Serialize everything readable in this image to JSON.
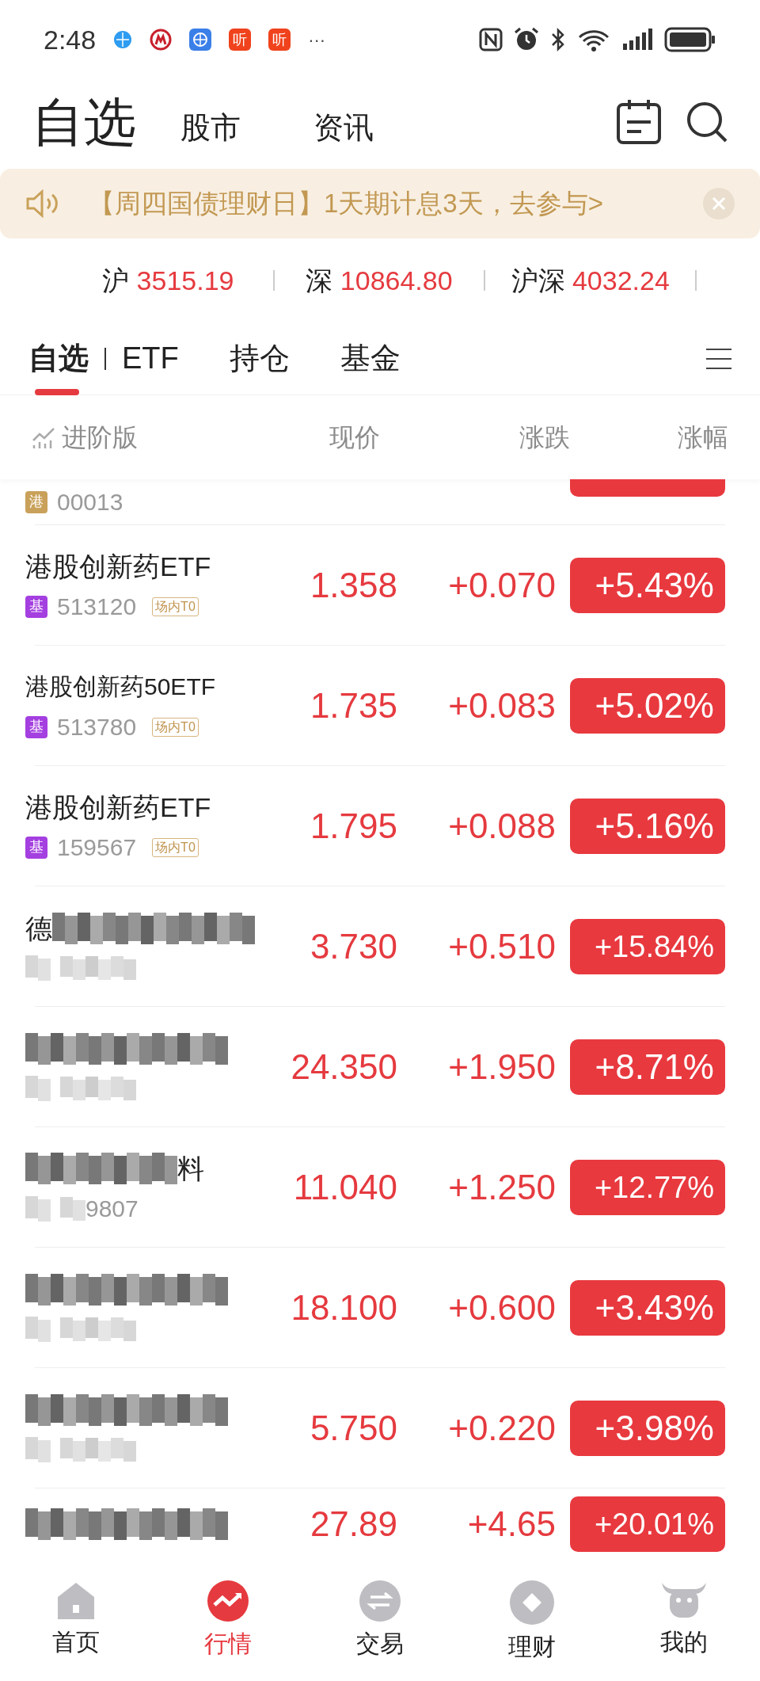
{
  "status_bar": {
    "time": "2:48",
    "notifications": [
      {
        "kind": "globe"
      },
      {
        "kind": "metro"
      },
      {
        "kind": "browser"
      },
      {
        "kind": "app",
        "label": "听"
      },
      {
        "kind": "app",
        "label": "听"
      }
    ],
    "more": "···"
  },
  "header": {
    "title": "自选",
    "tabs": [
      {
        "label": "股市",
        "selected": false
      },
      {
        "label": "资讯",
        "selected": false
      }
    ]
  },
  "banner": {
    "text": "【周四国债理财日】1天期计息3天，去参与>"
  },
  "indices": [
    {
      "name": "沪",
      "value": "3515.19"
    },
    {
      "name": "深",
      "value": "10864.80"
    },
    {
      "name": "沪深",
      "value": "4032.24"
    }
  ],
  "list_tabs": [
    {
      "label": "自选",
      "selected": true
    },
    {
      "label": "ETF",
      "selected": false
    },
    {
      "label": "持仓",
      "selected": false
    },
    {
      "label": "基金",
      "selected": false
    }
  ],
  "columns": {
    "mode": "进阶版",
    "price": "现价",
    "change": "涨跌",
    "pct": "涨幅"
  },
  "rows": [
    {
      "kind": "partial",
      "badge": {
        "label": "港",
        "kind": "hk"
      },
      "code": "00013"
    },
    {
      "kind": "plain",
      "name": "港股创新药ETF",
      "badge": {
        "label": "基",
        "kind": "fund"
      },
      "code": "513120",
      "tag": "场内T0",
      "price": "1.358",
      "change": "+0.070",
      "pct": "+5.43%"
    },
    {
      "kind": "plain",
      "name": "港股创新药50ETF",
      "badge": {
        "label": "基",
        "kind": "fund"
      },
      "code": "513780",
      "tag": "场内T0",
      "price": "1.735",
      "change": "+0.083",
      "pct": "+5.02%"
    },
    {
      "kind": "plain",
      "name": "港股创新药ETF",
      "badge": {
        "label": "基",
        "kind": "fund"
      },
      "code": "159567",
      "tag": "场内T0",
      "price": "1.795",
      "change": "+0.088",
      "pct": "+5.16%"
    },
    {
      "kind": "blurred",
      "name": "德",
      "price": "3.730",
      "change": "+0.510",
      "pct": "+15.84%"
    },
    {
      "kind": "blurred",
      "price": "24.350",
      "change": "+1.950",
      "pct": "+8.71%"
    },
    {
      "kind": "blurred",
      "name_tail": "料",
      "code": "9807",
      "price": "11.040",
      "change": "+1.250",
      "pct": "+12.77%"
    },
    {
      "kind": "blurred",
      "price": "18.100",
      "change": "+0.600",
      "pct": "+3.43%"
    },
    {
      "kind": "blurred",
      "price": "5.750",
      "change": "+0.220",
      "pct": "+3.98%"
    },
    {
      "kind": "cut",
      "price": "27.89",
      "change": "+4.65",
      "pct": "+20.01%"
    }
  ],
  "bottom_nav": [
    {
      "label": "首页",
      "kind": "home",
      "selected": false
    },
    {
      "label": "行情",
      "kind": "market",
      "selected": true
    },
    {
      "label": "交易",
      "kind": "trade",
      "selected": false
    },
    {
      "label": "理财",
      "kind": "wealth",
      "selected": false
    },
    {
      "label": "我的",
      "kind": "me",
      "selected": false
    }
  ]
}
